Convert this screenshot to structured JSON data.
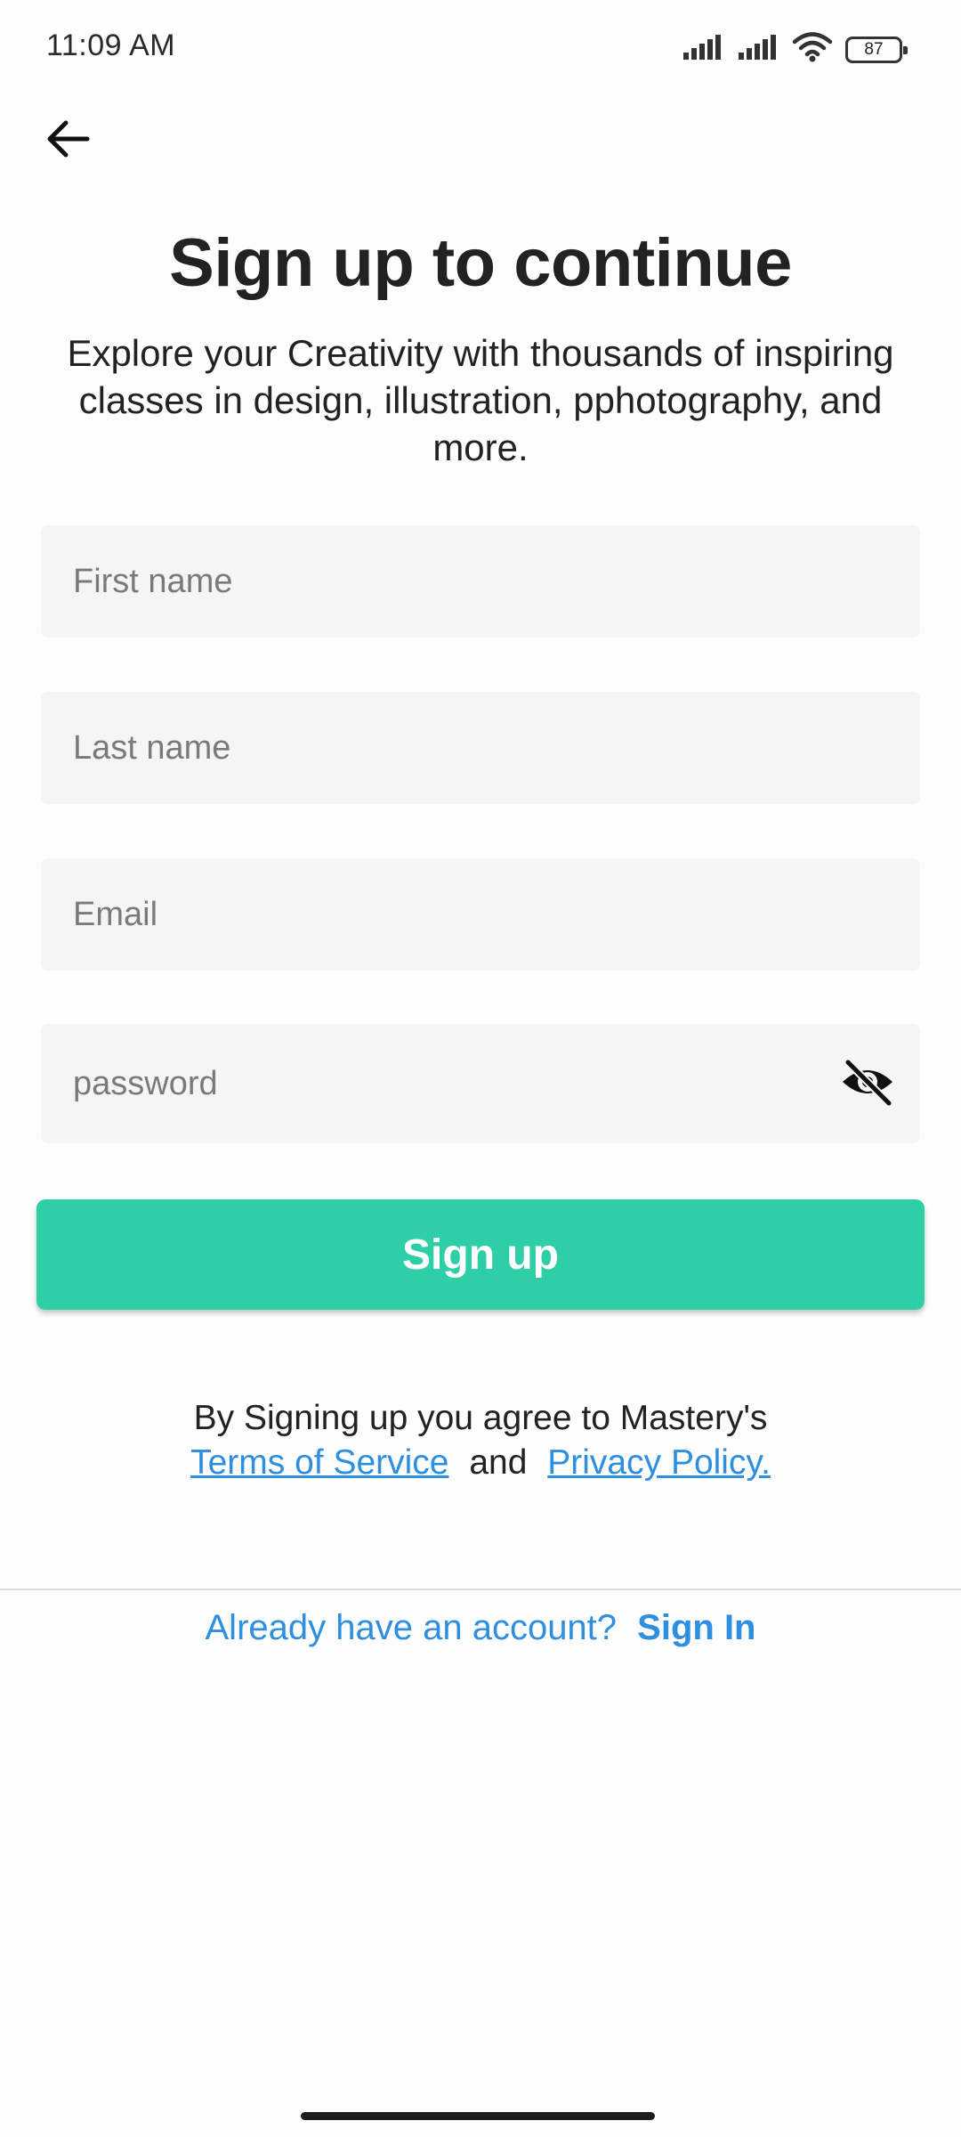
{
  "status_bar": {
    "time": "11:09 AM",
    "battery": "87",
    "icons": [
      "signal-icon",
      "signal-icon",
      "wifi-icon",
      "battery-icon"
    ]
  },
  "header": {
    "back_icon": "arrow-left-icon"
  },
  "main": {
    "title": "Sign up to continue",
    "subtitle": "Explore your Creativity with thousands of inspiring classes in design, illustration, pphotography, and more."
  },
  "form": {
    "first_name": {
      "placeholder": "First name",
      "value": ""
    },
    "last_name": {
      "placeholder": "Last name",
      "value": ""
    },
    "email": {
      "placeholder": "Email",
      "value": ""
    },
    "password": {
      "placeholder": "password",
      "value": "",
      "toggle_icon": "eye-off-icon"
    },
    "submit_label": "Sign up"
  },
  "terms": {
    "prefix": "By Signing up you agree to Mastery's",
    "terms_link": "Terms of Service",
    "conjunction": "and",
    "privacy_link": "Privacy Policy."
  },
  "footer": {
    "prompt": "Already have an account?",
    "signin_label": "Sign In"
  },
  "colors": {
    "accent": "#2ecfa6",
    "link": "#2e8fe0",
    "field_bg": "#f5f5f5"
  }
}
